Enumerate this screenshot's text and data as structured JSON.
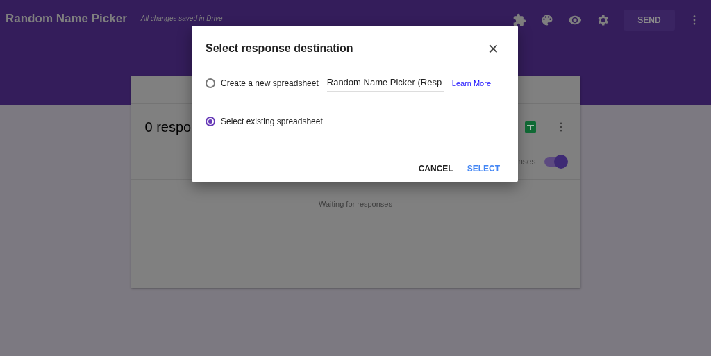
{
  "header": {
    "title": "Random Name Picker",
    "save_status": "All changes saved in Drive",
    "send_button": "SEND"
  },
  "responses_card": {
    "count": "0 respo",
    "accepting_label": "nses",
    "accepting": {
      "on": true
    },
    "empty_message": "Waiting for responses"
  },
  "dialog": {
    "title": "Select response destination",
    "close": "×",
    "options": [
      {
        "kind": "new",
        "label": "Create a new spreadsheet",
        "selected": false,
        "value": "Random Name Picker (Resp",
        "link": "Learn More"
      },
      {
        "kind": "existing",
        "label": "Select existing spreadsheet",
        "selected": true
      }
    ],
    "buttons": [
      {
        "kind": "cancel",
        "label": "CANCEL"
      },
      {
        "kind": "primary",
        "label": "SELECT"
      }
    ]
  }
}
